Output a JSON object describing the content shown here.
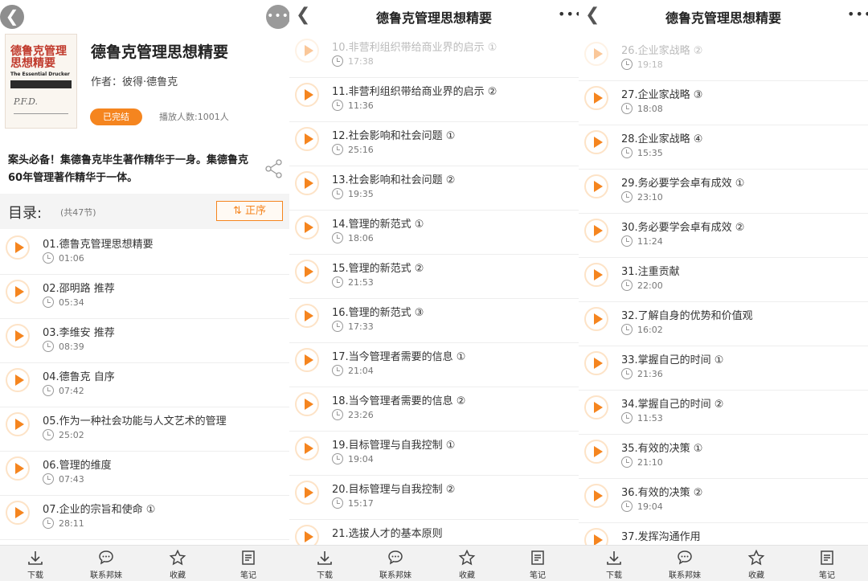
{
  "book": {
    "title": "德鲁克管理思想精要",
    "author": "作者：彼得·德鲁克",
    "status": "已完结",
    "play_count": "播放人数:1001人",
    "description": "案头必备！集德鲁克毕生著作精华于一身。集德鲁克60年管理著作精华于一体。",
    "cover": {
      "title_line1": "德鲁克管理",
      "title_line2": "思想精要",
      "subtitle": "The Essential Drucker"
    }
  },
  "toc": {
    "label": "目录:",
    "count": "(共47节)",
    "sort_label": "正序"
  },
  "nav": {
    "back_glyph": "❮",
    "more_glyph": "•••",
    "header_title": "德鲁克管理思想精要"
  },
  "panel1_episodes": [
    {
      "name": "01.德鲁克管理思想精要",
      "duration": "01:06"
    },
    {
      "name": "02.邵明路 推荐",
      "duration": "05:34"
    },
    {
      "name": "03.李维安 推荐",
      "duration": "08:39"
    },
    {
      "name": "04.德鲁克 自序",
      "duration": "07:42"
    },
    {
      "name": "05.作为一种社会功能与人文艺术的管理",
      "duration": "25:02"
    },
    {
      "name": "06.管理的维度",
      "duration": "07:43"
    },
    {
      "name": "07.企业的宗旨和使命 ①",
      "duration": "28:11"
    }
  ],
  "panel2_episodes": [
    {
      "name": "10.非营利组织带给商业界的启示 ①",
      "duration": "17:38"
    },
    {
      "name": "11.非营利组织带给商业界的启示 ②",
      "duration": "11:36"
    },
    {
      "name": "12.社会影响和社会问题 ①",
      "duration": "25:16"
    },
    {
      "name": "13.社会影响和社会问题 ②",
      "duration": "19:35"
    },
    {
      "name": "14.管理的新范式 ①",
      "duration": "18:06"
    },
    {
      "name": "15.管理的新范式 ②",
      "duration": "21:53"
    },
    {
      "name": "16.管理的新范式 ③",
      "duration": "17:33"
    },
    {
      "name": "17.当今管理者需要的信息 ①",
      "duration": "21:04"
    },
    {
      "name": "18.当今管理者需要的信息 ②",
      "duration": "23:26"
    },
    {
      "name": "19.目标管理与自我控制 ①",
      "duration": "19:04"
    },
    {
      "name": "20.目标管理与自我控制 ②",
      "duration": "15:17"
    },
    {
      "name": "21.选拔人才的基本原则",
      "duration": ""
    }
  ],
  "panel3_episodes": [
    {
      "name": "26.企业家战略 ②",
      "duration": "19:18"
    },
    {
      "name": "27.企业家战略 ③",
      "duration": "18:08"
    },
    {
      "name": "28.企业家战略 ④",
      "duration": "15:35"
    },
    {
      "name": "29.务必要学会卓有成效 ①",
      "duration": "23:10"
    },
    {
      "name": "30.务必要学会卓有成效 ②",
      "duration": "11:24"
    },
    {
      "name": "31.注重贡献",
      "duration": "22:00"
    },
    {
      "name": "32.了解自身的优势和价值观",
      "duration": "16:02"
    },
    {
      "name": "33.掌握自己的时间 ①",
      "duration": "21:36"
    },
    {
      "name": "34.掌握自己的时间 ②",
      "duration": "11:53"
    },
    {
      "name": "35.有效的决策 ①",
      "duration": "21:10"
    },
    {
      "name": "36.有效的决策 ②",
      "duration": "19:04"
    },
    {
      "name": "37.发挥沟通作用",
      "duration": ""
    }
  ],
  "toolbar": [
    {
      "label": "下载",
      "icon": "download-icon"
    },
    {
      "label": "联系邦妹",
      "icon": "chat-icon"
    },
    {
      "label": "收藏",
      "icon": "star-icon"
    },
    {
      "label": "笔记",
      "icon": "notes-icon"
    }
  ],
  "colors": {
    "accent": "#f5851f"
  }
}
